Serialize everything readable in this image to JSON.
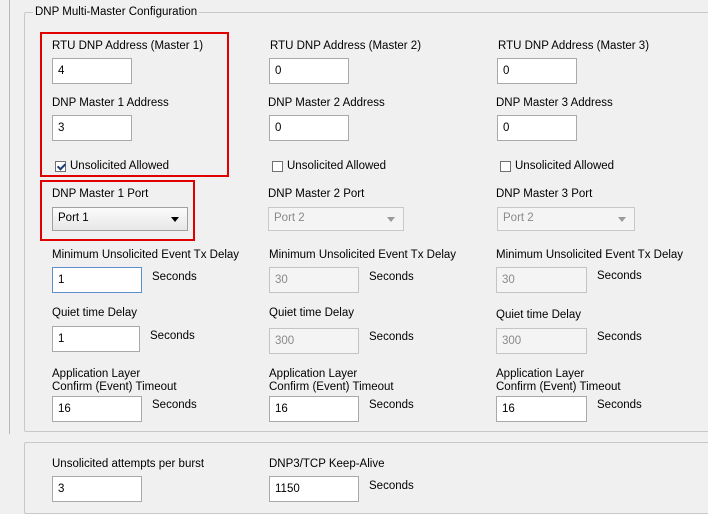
{
  "group_title": "DNP Multi-Master Configuration",
  "masters": [
    {
      "rtu_address_label": "RTU DNP Address (Master 1)",
      "rtu_address_value": "4",
      "master_address_label": "DNP Master 1 Address",
      "master_address_value": "3",
      "unsolicited_label": "Unsolicited Allowed",
      "unsolicited_checked": true,
      "port_label": "DNP Master 1 Port",
      "port_value": "Port 1",
      "port_enabled": true
    },
    {
      "rtu_address_label": "RTU DNP Address (Master 2)",
      "rtu_address_value": "0",
      "master_address_label": "DNP Master 2 Address",
      "master_address_value": "0",
      "unsolicited_label": "Unsolicited Allowed",
      "unsolicited_checked": false,
      "port_label": "DNP Master 2 Port",
      "port_value": "Port 2",
      "port_enabled": false
    },
    {
      "rtu_address_label": "RTU DNP Address (Master 3)",
      "rtu_address_value": "0",
      "master_address_label": "DNP Master 3 Address",
      "master_address_value": "0",
      "unsolicited_label": "Unsolicited Allowed",
      "unsolicited_checked": false,
      "port_label": "DNP Master 3 Port",
      "port_value": "Port 2",
      "port_enabled": false
    }
  ],
  "timing": [
    {
      "min_unsol_label": "Minimum Unsolicited Event Tx Delay",
      "min_unsol_value": "1",
      "quiet_label": "Quiet time Delay",
      "quiet_value": "1",
      "app_layer_label_line1": "Application Layer",
      "app_layer_label_line2": "Confirm (Event) Timeout",
      "app_layer_value": "16",
      "seconds": "Seconds"
    },
    {
      "min_unsol_label": "Minimum Unsolicited Event Tx Delay",
      "min_unsol_value": "30",
      "quiet_label": "Quiet time Delay",
      "quiet_value": "300",
      "app_layer_label_line1": "Application Layer",
      "app_layer_label_line2": "Confirm (Event) Timeout",
      "app_layer_value": "16",
      "seconds": "Seconds"
    },
    {
      "min_unsol_label": "Minimum Unsolicited Event Tx Delay",
      "min_unsol_value": "30",
      "quiet_label": "Quiet time Delay",
      "quiet_value": "300",
      "app_layer_label_line1": "Application Layer",
      "app_layer_label_line2": "Confirm (Event) Timeout",
      "app_layer_value": "16",
      "seconds": "Seconds"
    }
  ],
  "bottom": {
    "unsol_attempts_label": "Unsolicited attempts per burst",
    "unsol_attempts_value": "3",
    "keepalive_label": "DNP3/TCP Keep-Alive",
    "keepalive_value": "1150",
    "keepalive_unit": "Seconds"
  },
  "colors": {
    "highlight": "#e00000",
    "window_bg": "#f0f0f0"
  }
}
